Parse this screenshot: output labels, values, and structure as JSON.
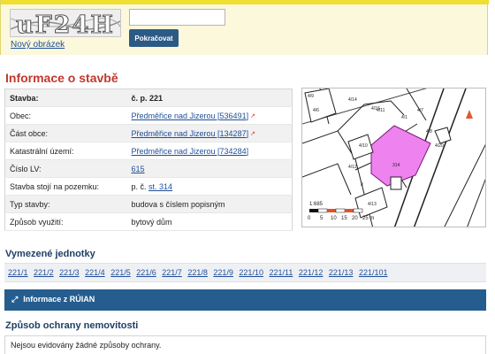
{
  "captcha": {
    "image_text": "uF24H",
    "new_image_label": "Nový obrázek",
    "input_value": "",
    "continue_label": "Pokračovat"
  },
  "building_info": {
    "title": "Informace o stavbě",
    "rows": [
      {
        "label": "Stavba:",
        "value": "č. p. 221"
      },
      {
        "label": "Obec:",
        "value": "Předměřice nad Jizerou [536491]"
      },
      {
        "label": "Část obce:",
        "value": "Předměřice nad Jizerou [134287]"
      },
      {
        "label": "Katastrální území:",
        "value": "Předměřice nad Jizerou [734284]"
      },
      {
        "label": "Číslo LV:",
        "value": "615"
      },
      {
        "label": "Stavba stojí na pozemku:",
        "value_prefix": "p. č.",
        "value_link": "st. 314"
      },
      {
        "label": "Typ stavby:",
        "value": "budova s číslem popisným"
      },
      {
        "label": "Způsob využití:",
        "value": "bytový dům"
      }
    ]
  },
  "map": {
    "scale_label": "1:685",
    "scale_ticks": [
      "0",
      "5",
      "10",
      "15",
      "20",
      "25 m"
    ],
    "parcel_labels": [
      "4/9",
      "4/14",
      "4/7",
      "4/8",
      "4/16",
      "4/1",
      "4/10",
      "4/12",
      "4/13",
      "4/11",
      "4/20",
      "4/6",
      "314",
      "II"
    ],
    "highlight_color": "#ee82ee"
  },
  "units": {
    "title": "Vymezené jednotky",
    "items": [
      "221/1",
      "221/2",
      "221/3",
      "221/4",
      "221/5",
      "221/6",
      "221/7",
      "221/8",
      "221/9",
      "221/10",
      "221/11",
      "221/12",
      "221/13",
      "221/101"
    ]
  },
  "ruian": {
    "label": "Informace z RÚIAN"
  },
  "protection": {
    "title": "Způsob ochrany nemovitosti",
    "text": "Nejsou evidovány žádné způsoby ochrany."
  }
}
